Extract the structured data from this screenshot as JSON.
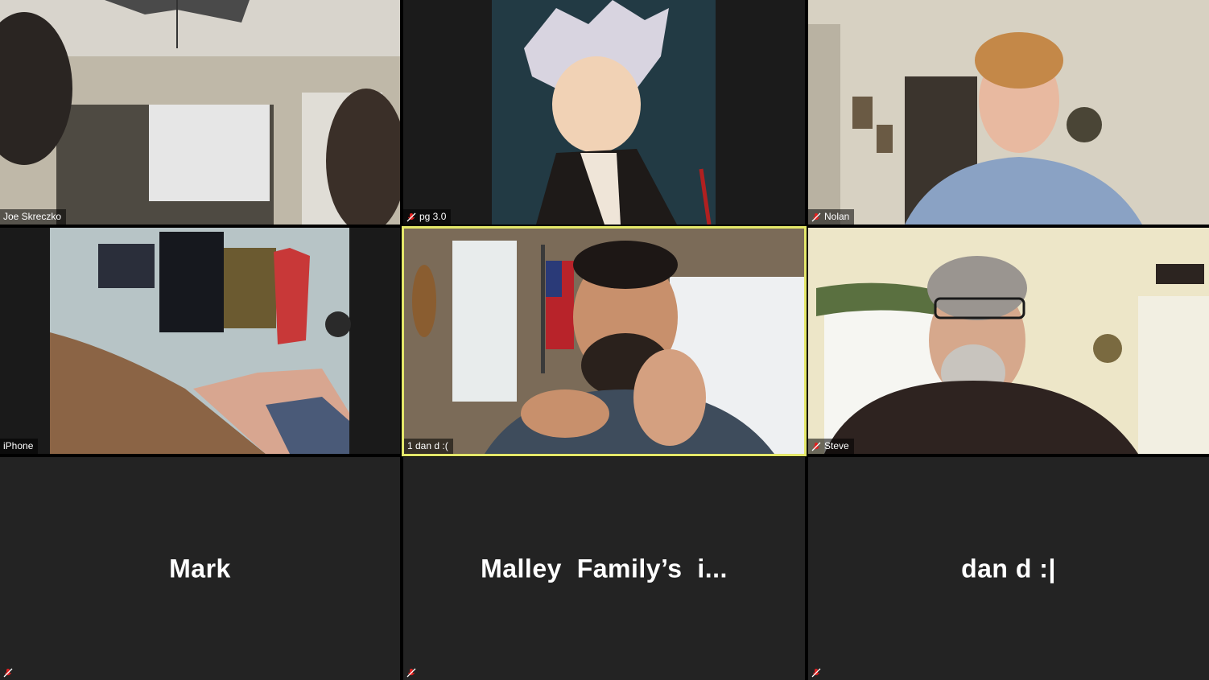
{
  "participants": [
    {
      "name": "Joe Skreczko",
      "muted": false
    },
    {
      "name": "pg 3.0",
      "muted": true
    },
    {
      "name": "Nolan",
      "muted": true
    },
    {
      "name": "iPhone",
      "muted": false
    },
    {
      "name": "1 dan d :(",
      "muted": false,
      "active_speaker": true
    },
    {
      "name": "Steve",
      "muted": true
    },
    {
      "name": "Mark",
      "muted": true,
      "video": "off"
    },
    {
      "name": "Malley  Family’s  i...",
      "muted": true,
      "video": "off"
    },
    {
      "name": "dan d :|",
      "muted": true,
      "video": "off"
    }
  ],
  "colors": {
    "active_speaker_border": "#e4e86a",
    "muted_icon": "#e02020",
    "tile_off_bg": "#232323"
  },
  "icons": {
    "mute": "microphone-muted-icon"
  }
}
